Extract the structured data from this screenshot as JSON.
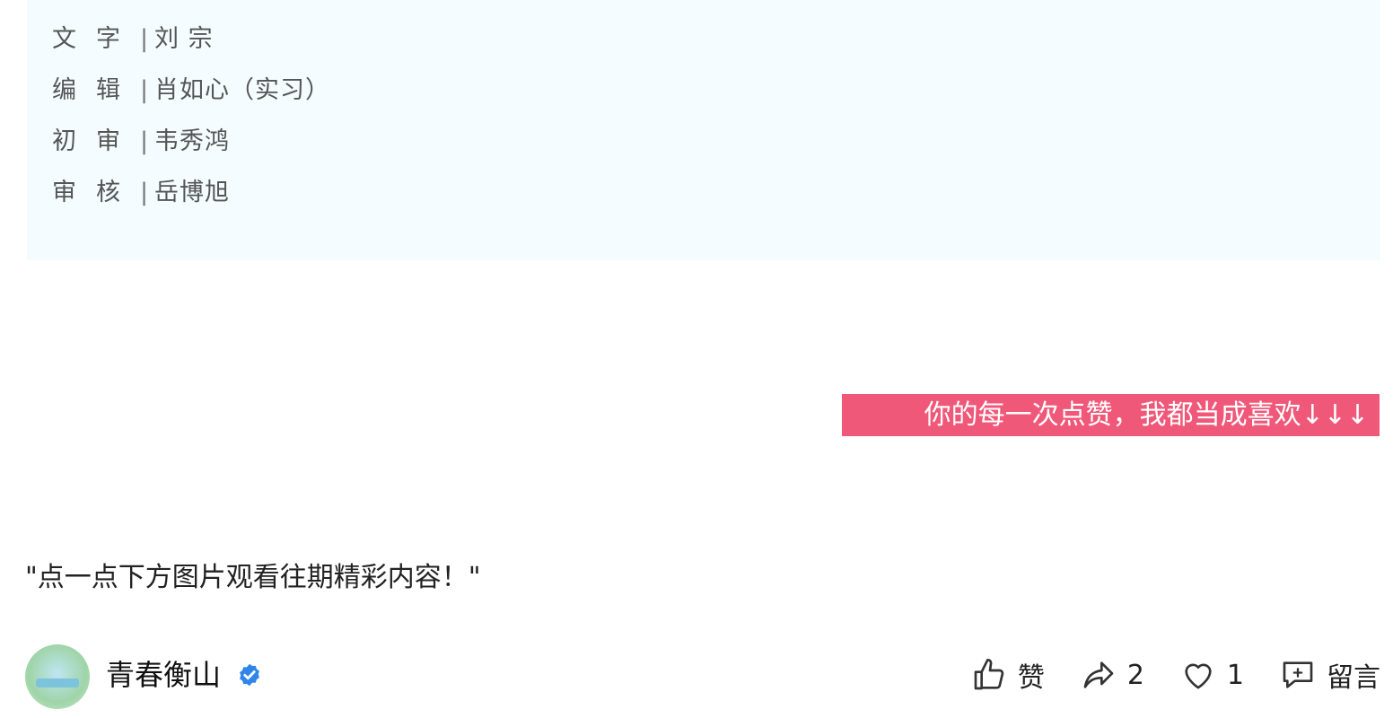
{
  "credits": [
    {
      "role": "文字",
      "name": "刘 宗"
    },
    {
      "role": "编辑",
      "name": "肖如心（实习）"
    },
    {
      "role": "初审",
      "name": "韦秀鸿"
    },
    {
      "role": "审核",
      "name": "岳博旭"
    }
  ],
  "separator": "|",
  "banner_text": "你的每一次点赞，我都当成喜欢↓↓↓",
  "promo_text": "\"点一点下方图片观看往期精彩内容！\"",
  "account": {
    "name": "青春衡山"
  },
  "actions": {
    "like_label": "赞",
    "share_count": "2",
    "favorite_count": "1",
    "comment_label": "留言"
  }
}
